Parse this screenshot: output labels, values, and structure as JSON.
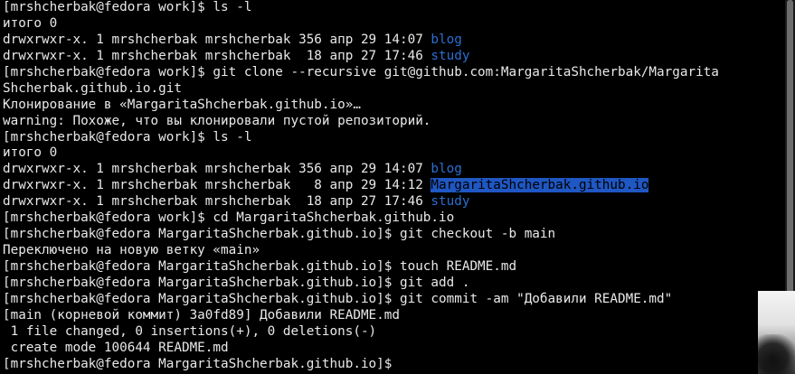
{
  "terminal": {
    "lines": [
      {
        "prefix": "[mrshcherbak@fedora work]$ ls -l",
        "dir": "",
        "suffix": ""
      },
      {
        "prefix": "итого 0",
        "dir": "",
        "suffix": ""
      },
      {
        "prefix": "drwxrwxr-x. 1 mrshcherbak mrshcherbak 356 апр 29 14:07 ",
        "dir": "blog",
        "suffix": ""
      },
      {
        "prefix": "drwxrwxr-x. 1 mrshcherbak mrshcherbak  18 апр 27 17:46 ",
        "dir": "study",
        "suffix": ""
      },
      {
        "prefix": "[mrshcherbak@fedora work]$ git clone --recursive git@github.com:MargaritaShcherbak/Margarita",
        "dir": "",
        "suffix": ""
      },
      {
        "prefix": "Shcherbak.github.io.git",
        "dir": "",
        "suffix": ""
      },
      {
        "prefix": "Клонирование в «MargaritaShcherbak.github.io»…",
        "dir": "",
        "suffix": ""
      },
      {
        "prefix": "warning: Похоже, что вы клонировали пустой репозиторий.",
        "dir": "",
        "suffix": ""
      },
      {
        "prefix": "[mrshcherbak@fedora work]$ ls -l",
        "dir": "",
        "suffix": ""
      },
      {
        "prefix": "итого 0",
        "dir": "",
        "suffix": ""
      },
      {
        "prefix": "drwxrwxr-x. 1 mrshcherbak mrshcherbak 356 апр 29 14:07 ",
        "dir": "blog",
        "suffix": ""
      },
      {
        "prefix": "drwxrwxr-x. 1 mrshcherbak mrshcherbak   8 апр 29 14:12 ",
        "dir_highlight": "MargaritaShcherbak.github.io",
        "suffix": ""
      },
      {
        "prefix": "drwxrwxr-x. 1 mrshcherbak mrshcherbak  18 апр 27 17:46 ",
        "dir": "study",
        "suffix": ""
      },
      {
        "prefix": "[mrshcherbak@fedora work]$ cd MargaritaShcherbak.github.io",
        "dir": "",
        "suffix": ""
      },
      {
        "prefix": "[mrshcherbak@fedora MargaritaShcherbak.github.io]$ git checkout -b main",
        "dir": "",
        "suffix": ""
      },
      {
        "prefix": "Переключено на новую ветку «main»",
        "dir": "",
        "suffix": ""
      },
      {
        "prefix": "[mrshcherbak@fedora MargaritaShcherbak.github.io]$ touch README.md",
        "dir": "",
        "suffix": ""
      },
      {
        "prefix": "[mrshcherbak@fedora MargaritaShcherbak.github.io]$ git add .",
        "dir": "",
        "suffix": ""
      },
      {
        "prefix": "[mrshcherbak@fedora MargaritaShcherbak.github.io]$ git commit -am \"Добавили README.md\"",
        "dir": "",
        "suffix": ""
      },
      {
        "prefix": "[main (корневой коммит) 3a0fd89] Добавили README.md",
        "dir": "",
        "suffix": ""
      },
      {
        "prefix": " 1 file changed, 0 insertions(+), 0 deletions(-)",
        "dir": "",
        "suffix": ""
      },
      {
        "prefix": " create mode 100644 README.md",
        "dir": "",
        "suffix": ""
      },
      {
        "prefix": "[mrshcherbak@fedora MargaritaShcherbak.github.io]$ ",
        "dir": "",
        "suffix": ""
      }
    ]
  },
  "colors": {
    "background": "#000000",
    "text": "#e9e9e9",
    "directory": "#2a6fd1",
    "selection": "#1f57c3"
  },
  "icons": {
    "scrollbar": "scrollbar-thumb"
  }
}
